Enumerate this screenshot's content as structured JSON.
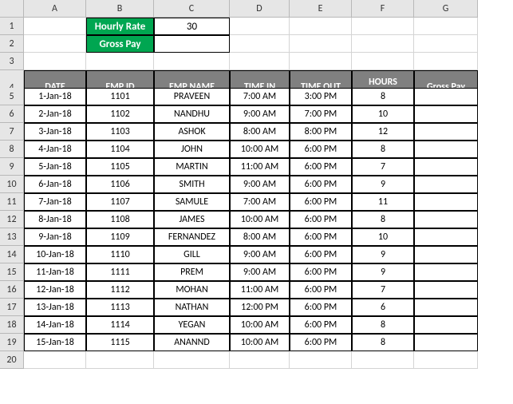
{
  "columns": [
    "A",
    "B",
    "C",
    "D",
    "E",
    "F",
    "G"
  ],
  "row_numbers": [
    1,
    2,
    3,
    4,
    5,
    6,
    7,
    8,
    9,
    10,
    11,
    12,
    13,
    14,
    15,
    16,
    17,
    18,
    19,
    20
  ],
  "labels": {
    "hourly_rate": "Hourly Rate",
    "gross_pay": "Gross Pay",
    "hourly_rate_value": "30"
  },
  "table_headers": {
    "date": "DATE",
    "emp_id": "EMP ID",
    "emp_name": "EMP NAME",
    "time_in": "TIME IN",
    "time_out": "TIME OUT",
    "hours_worked": "HOURS WORKED",
    "gross_pay": "Gross Pay"
  },
  "rows": [
    {
      "date": "1-Jan-18",
      "emp_id": "1101",
      "emp_name": "PRAVEEN",
      "time_in": "7:00 AM",
      "time_out": "3:00 PM",
      "hours_worked": "8",
      "gross_pay": ""
    },
    {
      "date": "2-Jan-18",
      "emp_id": "1102",
      "emp_name": "NANDHU",
      "time_in": "9:00 AM",
      "time_out": "7:00 PM",
      "hours_worked": "10",
      "gross_pay": ""
    },
    {
      "date": "3-Jan-18",
      "emp_id": "1103",
      "emp_name": "ASHOK",
      "time_in": "8:00 AM",
      "time_out": "8:00 PM",
      "hours_worked": "12",
      "gross_pay": ""
    },
    {
      "date": "4-Jan-18",
      "emp_id": "1104",
      "emp_name": "JOHN",
      "time_in": "10:00 AM",
      "time_out": "6:00 PM",
      "hours_worked": "8",
      "gross_pay": ""
    },
    {
      "date": "5-Jan-18",
      "emp_id": "1105",
      "emp_name": "MARTIN",
      "time_in": "11:00 AM",
      "time_out": "6:00 PM",
      "hours_worked": "7",
      "gross_pay": ""
    },
    {
      "date": "6-Jan-18",
      "emp_id": "1106",
      "emp_name": "SMITH",
      "time_in": "9:00 AM",
      "time_out": "6:00 PM",
      "hours_worked": "9",
      "gross_pay": ""
    },
    {
      "date": "7-Jan-18",
      "emp_id": "1107",
      "emp_name": "SAMULE",
      "time_in": "7:00 AM",
      "time_out": "6:00 PM",
      "hours_worked": "11",
      "gross_pay": ""
    },
    {
      "date": "8-Jan-18",
      "emp_id": "1108",
      "emp_name": "JAMES",
      "time_in": "10:00 AM",
      "time_out": "6:00 PM",
      "hours_worked": "8",
      "gross_pay": ""
    },
    {
      "date": "9-Jan-18",
      "emp_id": "1109",
      "emp_name": "FERNANDEZ",
      "time_in": "8:00 AM",
      "time_out": "6:00 PM",
      "hours_worked": "10",
      "gross_pay": ""
    },
    {
      "date": "10-Jan-18",
      "emp_id": "1110",
      "emp_name": "GILL",
      "time_in": "9:00 AM",
      "time_out": "6:00 PM",
      "hours_worked": "9",
      "gross_pay": ""
    },
    {
      "date": "11-Jan-18",
      "emp_id": "1111",
      "emp_name": "PREM",
      "time_in": "9:00 AM",
      "time_out": "6:00 PM",
      "hours_worked": "9",
      "gross_pay": ""
    },
    {
      "date": "12-Jan-18",
      "emp_id": "1112",
      "emp_name": "MOHAN",
      "time_in": "11:00 AM",
      "time_out": "6:00 PM",
      "hours_worked": "7",
      "gross_pay": ""
    },
    {
      "date": "13-Jan-18",
      "emp_id": "1113",
      "emp_name": "NATHAN",
      "time_in": "12:00 PM",
      "time_out": "6:00 PM",
      "hours_worked": "6",
      "gross_pay": ""
    },
    {
      "date": "14-Jan-18",
      "emp_id": "1114",
      "emp_name": "YEGAN",
      "time_in": "10:00 AM",
      "time_out": "6:00 PM",
      "hours_worked": "8",
      "gross_pay": ""
    },
    {
      "date": "15-Jan-18",
      "emp_id": "1115",
      "emp_name": "ANANND",
      "time_in": "10:00 AM",
      "time_out": "6:00 PM",
      "hours_worked": "8",
      "gross_pay": ""
    }
  ]
}
